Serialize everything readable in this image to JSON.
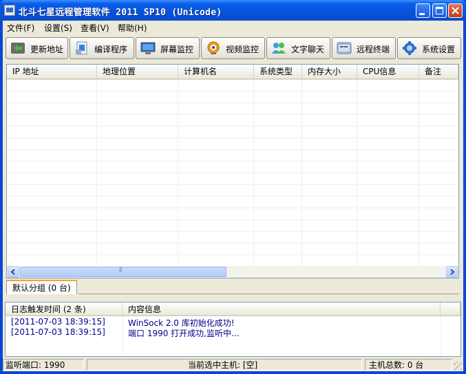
{
  "window": {
    "title": "北斗七星远程管理软件  2011 SP10 (Unicode)"
  },
  "menu": [
    {
      "label": "文件(F)"
    },
    {
      "label": "设置(S)"
    },
    {
      "label": "查看(V)"
    },
    {
      "label": "帮助(H)"
    }
  ],
  "toolbar": [
    {
      "label": "更新地址",
      "icon": "refresh-address-icon"
    },
    {
      "label": "编译程序",
      "icon": "compile-program-icon"
    },
    {
      "label": "屏幕监控",
      "icon": "screen-monitor-icon"
    },
    {
      "label": "视频监控",
      "icon": "webcam-icon"
    },
    {
      "label": "文字聊天",
      "icon": "chat-users-icon"
    },
    {
      "label": "远程终端",
      "icon": "remote-terminal-icon"
    },
    {
      "label": "系统设置",
      "icon": "settings-gear-icon"
    }
  ],
  "host_list": {
    "columns": [
      "IP 地址",
      "地理位置",
      "计算机名",
      "系统类型",
      "内存大小",
      "CPU信息",
      "备注"
    ],
    "rows": [],
    "scroll_thumb_glyph": "⦀"
  },
  "tabs": [
    {
      "label": "默认分组 (0 台)",
      "selected": true
    }
  ],
  "log": {
    "columns": [
      "日志触发时间 (2 条)",
      "内容信息"
    ],
    "rows": [
      {
        "time": "[2011-07-03 18:39:15]",
        "message": "WinSock 2.0 库初始化成功!"
      },
      {
        "time": "[2011-07-03 18:39:15]",
        "message": "端口 1990 打开成功,监听中..."
      }
    ]
  },
  "status": {
    "port": "监听端口: 1990",
    "selected_host": "当前选中主机: [空]",
    "host_count": "主机总数: 0 台"
  },
  "colors": {
    "title_bar": "#0a5ee8",
    "log_text": "#00008b",
    "tab_accent": "#f6a427"
  }
}
